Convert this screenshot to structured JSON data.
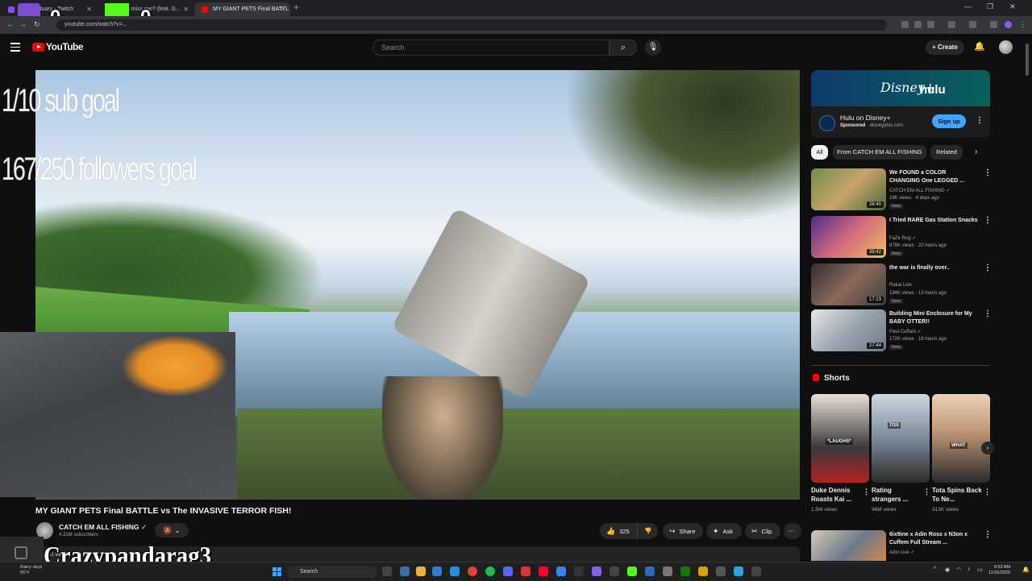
{
  "browser": {
    "tabs": [
      {
        "title": "rwysanctuary - Twitch",
        "active": false,
        "color": "#9146ff"
      },
      {
        "title": "W - u miss me? (feat. G...",
        "active": false,
        "color": "#53fc18"
      },
      {
        "title": "MY GIANT PETS Final BATTL",
        "active": true,
        "color": "#ff0000"
      }
    ],
    "url": "youtube.com/watch?v=...",
    "new_tab_icon": "plus-icon"
  },
  "stream_overlay": {
    "twitch_count": "0",
    "kick_count": "0",
    "sub_goal": "1/10 sub goal",
    "follower_goal": "167/250 followers goal",
    "streamer_name": "Crazypandarag3"
  },
  "header": {
    "logo_text": "YouTube",
    "search_placeholder": "Search",
    "create_label": "+ Create"
  },
  "video": {
    "title": "MY GIANT PETS Final BATTLE vs The INVASIVE TERROR FISH!",
    "channel": "CATCH EM ALL FISHING",
    "subscribers": "4.31M subscribers",
    "likes": "325",
    "share": "Share",
    "ask": "Ask",
    "clip": "Clip",
    "description_snippet": "31 vie..."
  },
  "ad": {
    "brand_disney": "Disney+",
    "brand_hulu": "hulu",
    "title": "Hulu on Disney+",
    "sponsored": "Sponsored",
    "domain": "disneyplus.com",
    "cta": "Sign up"
  },
  "chips": [
    "All",
    "From CATCH EM ALL FISHING",
    "Related"
  ],
  "recommendations": [
    {
      "title": "We FOUND a COLOR CHANGING One LEGGED ...",
      "channel": "CATCH EM ALL FISHING",
      "verified": true,
      "meta": "18K views · 4 days ago",
      "badge": "New",
      "duration": "28:40"
    },
    {
      "title": "I Tried RARE Gas Station Snacks",
      "channel": "FaZe Rug",
      "verified": true,
      "meta": "678K views · 20 hours ago",
      "badge": "New",
      "duration": "39:42"
    },
    {
      "title": "the war is finally over..",
      "channel": "Rakai Live",
      "verified": false,
      "meta": "194K views · 13 hours ago",
      "badge": "New",
      "duration": "17:23"
    },
    {
      "title": "Building Mini Enclosure for My BABY OTTER!!",
      "channel": "Paul Cuffaro",
      "verified": true,
      "meta": "172K views · 19 hours ago",
      "badge": "New",
      "duration": "27:44"
    }
  ],
  "shorts": {
    "heading": "Shorts",
    "items": [
      {
        "title": "Duke Dennis Roasts Kai ...",
        "views": "1.5M views",
        "caption": "*LAUGHS*"
      },
      {
        "title": "Rating strangers ...",
        "views": "96M views",
        "caption": "7/10"
      },
      {
        "title": "Tota Spins Back To Ne...",
        "views": "313K views",
        "caption": "WHAT"
      }
    ]
  },
  "rec_bottom": {
    "title": "6ix9ine x Adin Ross x N3on x Cuffem Full Stream ...",
    "channel": "Adin Live",
    "verified": true
  },
  "taskbar": {
    "weather_line1": "Rainy days",
    "weather_line2": "55°F",
    "search_label": "Search",
    "time": "9:53 AM",
    "date": "11/16/2025"
  },
  "colors": {
    "youtube_red": "#ff0000",
    "accent_blue": "#3ea6ff",
    "background": "#0f0f0f"
  }
}
